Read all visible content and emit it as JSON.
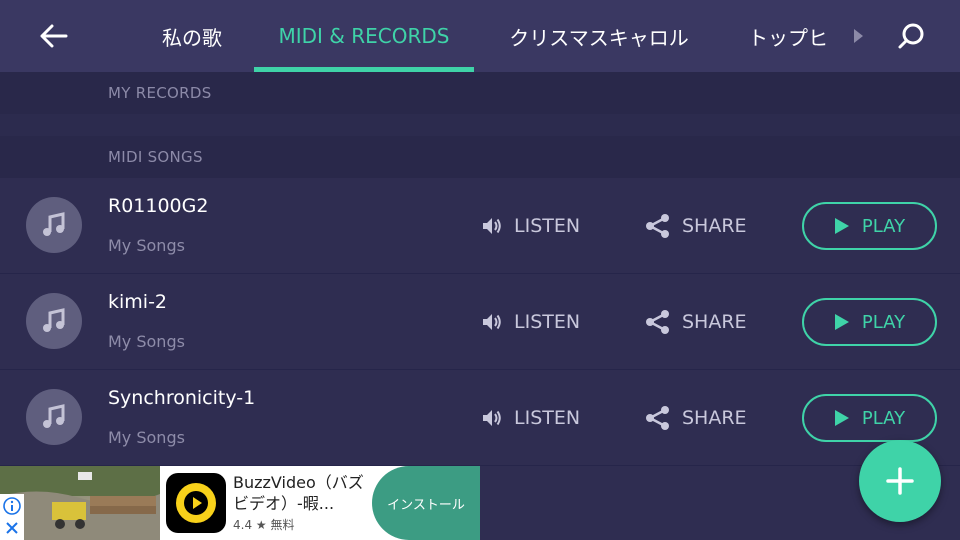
{
  "colors": {
    "accent": "#3fd3a8",
    "header_bg": "#3a3862",
    "list_bg": "#2f2d51",
    "section_bg": "#29284a"
  },
  "header": {
    "tabs": [
      {
        "label": "私の歌",
        "active": false
      },
      {
        "label": "MIDI & RECORDS",
        "active": true
      },
      {
        "label": "クリスマスキャロル",
        "active": false
      },
      {
        "label": "トップヒ",
        "active": false
      }
    ]
  },
  "sections": {
    "my_records": "MY RECORDS",
    "midi_songs": "MIDI SONGS"
  },
  "songs": [
    {
      "title": "R01100G2",
      "subtitle": "My Songs",
      "listen": "LISTEN",
      "share": "SHARE",
      "play": "PLAY"
    },
    {
      "title": "kimi-2",
      "subtitle": "My Songs",
      "listen": "LISTEN",
      "share": "SHARE",
      "play": "PLAY"
    },
    {
      "title": "Synchronicity-1",
      "subtitle": "My Songs",
      "listen": "LISTEN",
      "share": "SHARE",
      "play": "PLAY"
    }
  ],
  "ad": {
    "app_name": "BuzzVideo（バズビデオ）-暇...",
    "rating": "4.4",
    "price": "無料",
    "install_label": "インストール"
  }
}
